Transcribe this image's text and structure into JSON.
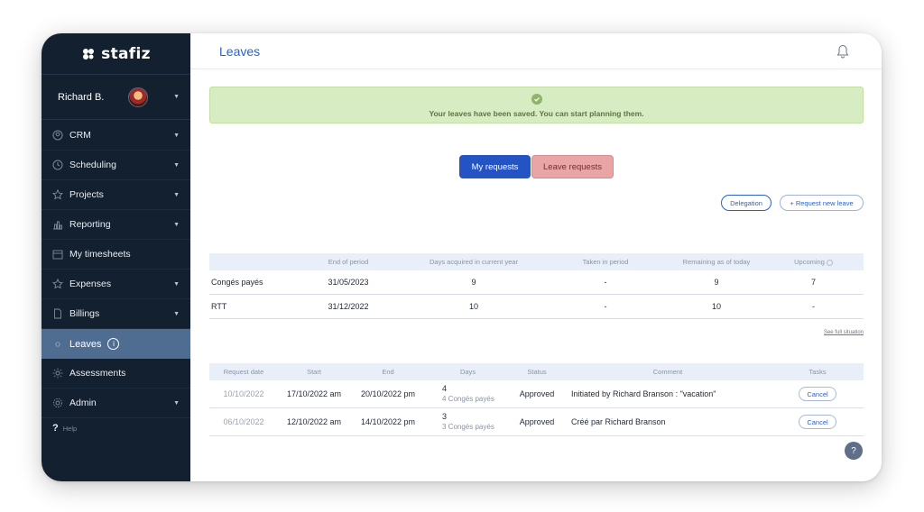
{
  "colors": {
    "sidebar": "#13202f",
    "accent": "#2b63c9",
    "active_nav": "#4f6d90",
    "alert_bg": "#d7ecc2",
    "leave_btn": "#e9a4a6"
  },
  "app": {
    "logo_text": "stafiz"
  },
  "user": {
    "name": "Richard B."
  },
  "nav": {
    "crm": "CRM",
    "scheduling": "Scheduling",
    "projects": "Projects",
    "reporting": "Reporting",
    "timesheets": "My timesheets",
    "expenses": "Expenses",
    "billings": "Billings",
    "leaves": "Leaves",
    "assessments": "Assessments",
    "admin": "Admin",
    "help": "Help"
  },
  "header": {
    "title": "Leaves"
  },
  "alert": {
    "message": "Your leaves have been saved. You can start planning them."
  },
  "toggle": {
    "my_requests": "My requests",
    "leave_requests": "Leave requests"
  },
  "actions": {
    "delegation": "Delegation",
    "request_new_leave": "+ Request new leave"
  },
  "balance": {
    "headers": [
      "",
      "End of period",
      "Days acquired in current year",
      "Taken in period",
      "Remaining as of today",
      "Upcoming"
    ],
    "rows": [
      [
        "Congés payés",
        "31/05/2023",
        "9",
        "-",
        "9",
        "7"
      ],
      [
        "RTT",
        "31/12/2022",
        "10",
        "-",
        "10",
        "-"
      ]
    ],
    "see_full": "See full situation"
  },
  "requests": {
    "headers": [
      "Request date",
      "Start",
      "End",
      "Days",
      "Status",
      "Comment",
      "Tasks"
    ],
    "rows": [
      {
        "request_date": "10/10/2022",
        "start": "17/10/2022 am",
        "end": "20/10/2022 pm",
        "days": "4",
        "days_detail": "4 Congés payés",
        "status": "Approved",
        "comment": "Initiated by Richard Branson : \"vacation\"",
        "task": "Cancel"
      },
      {
        "request_date": "06/10/2022",
        "start": "12/10/2022 am",
        "end": "14/10/2022 pm",
        "days": "3",
        "days_detail": "3 Congés payés",
        "status": "Approved",
        "comment": "Créé par Richard Branson",
        "task": "Cancel"
      }
    ]
  },
  "help_fab": "?"
}
